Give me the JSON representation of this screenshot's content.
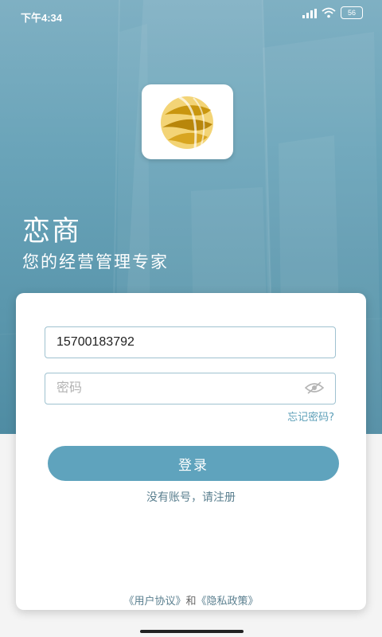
{
  "status_bar": {
    "time": "下午4:34",
    "battery": "56"
  },
  "brand": {
    "title": "恋商",
    "subtitle": "您的经营管理专家"
  },
  "login_form": {
    "phone_value": "15700183792",
    "password_placeholder": "密码",
    "forgot_password": "忘记密码?",
    "login_button": "登录",
    "register_link": "没有账号，请注册"
  },
  "footer": {
    "user_agreement": "《用户协议》",
    "and": "和",
    "privacy_policy": "《隐私政策》"
  },
  "colors": {
    "accent": "#5fa3bd",
    "background_top": "#7fb0c3",
    "logo_gold": "#d4a418"
  }
}
